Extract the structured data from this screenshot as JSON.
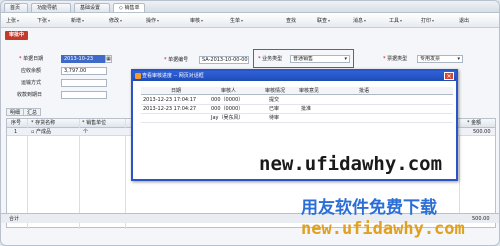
{
  "tabs": [
    {
      "label": "首页"
    },
    {
      "label": "功能导航"
    },
    {
      "label": "基础设置"
    },
    {
      "label": "销售单"
    }
  ],
  "toolbar": [
    {
      "label": "上张",
      "arrow": "▾"
    },
    {
      "label": "下张",
      "arrow": "▾"
    },
    {
      "label": "新增",
      "arrow": "▾"
    },
    {
      "label": "修改",
      "arrow": "▾"
    },
    {
      "label": "操作",
      "arrow": "▾"
    },
    {
      "label": "审核",
      "arrow": "▾"
    },
    {
      "label": "生单",
      "arrow": "▾"
    },
    {
      "label": "查找",
      "arrow": ""
    },
    {
      "label": "联查",
      "arrow": "▾"
    },
    {
      "label": "消息",
      "arrow": "▾"
    },
    {
      "label": "工具",
      "arrow": "▾"
    },
    {
      "label": "打印",
      "arrow": "▾"
    },
    {
      "label": "退出",
      "arrow": ""
    }
  ],
  "status": "审批中",
  "form": {
    "doc_date_label": "单据日期",
    "doc_date_value": "2013-10-23",
    "receivable_label": "应收余额",
    "receivable_value": "3,797.00",
    "transport_label": "运输方式",
    "due_date_label": "收款到期日",
    "doc_no_label": "单据编号",
    "doc_no_value": "SA-2013-10-00-0030",
    "biz_type_label": "业务类型",
    "biz_type_value": "普通销售",
    "invoice_type_label": "票据类型",
    "invoice_type_value": "专用发票"
  },
  "detail_tabs": [
    "明细",
    "汇总"
  ],
  "grid": {
    "headers": [
      "序号",
      "存货名称",
      "销售单位",
      "金额"
    ],
    "row": {
      "index": "1",
      "product": "产成品",
      "unit": "个",
      "amount": "500.00"
    },
    "total_label": "合计",
    "total_value": "500.00"
  },
  "dialog": {
    "title": "查看审核进度 -- 网页对话框",
    "close": "✕",
    "headers": [
      "日期",
      "审核人",
      "审核情况",
      "审核意见",
      "批语"
    ],
    "rows": [
      {
        "date": "2013-12-23 17:04:17",
        "reviewer": "000（0000）",
        "status": "提交",
        "opinion": ""
      },
      {
        "date": "2013-12-23 17:04:27",
        "reviewer": "000（0000）",
        "status": "已审",
        "opinion": "批准"
      },
      {
        "date": "",
        "reviewer": "Jay（吴东风）",
        "status": "待审",
        "opinion": ""
      }
    ]
  },
  "watermark": {
    "line1": "new.ufidawhy.com",
    "line2": "用友软件免费下载",
    "line3": "new.ufidawhy.com"
  }
}
